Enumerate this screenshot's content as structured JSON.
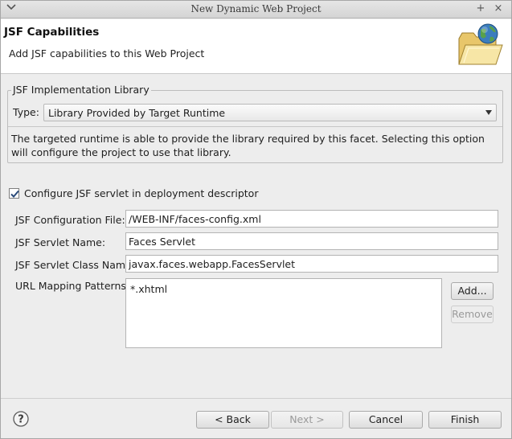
{
  "window": {
    "title": "New Dynamic Web Project",
    "titlebar_icons": [
      "+",
      "×"
    ]
  },
  "banner": {
    "heading": "JSF Capabilities",
    "description": "Add JSF capabilities to this Web Project",
    "image_icon": "folder-globe-icon"
  },
  "implementation": {
    "legend": "JSF Implementation Library",
    "type_label": "Type:",
    "type_value": "Library Provided by Target Runtime",
    "info": "The targeted runtime is able to provide the library required by this facet. Selecting this option will configure the project to use that library."
  },
  "servlet": {
    "checkbox_label": "Configure JSF servlet in deployment descriptor",
    "checked": true,
    "config_file_label": "JSF Configuration File:",
    "config_file_value": "/WEB-INF/faces-config.xml",
    "servlet_name_label": "JSF Servlet Name:",
    "servlet_name_value": "Faces Servlet",
    "servlet_class_label": "JSF Servlet Class Name:",
    "servlet_class_value": "javax.faces.webapp.FacesServlet",
    "url_patterns_label": "URL Mapping Patterns:",
    "url_patterns": [
      "*.xhtml"
    ],
    "add_label": "Add...",
    "remove_label": "Remove"
  },
  "footer": {
    "help_icon": "help-icon",
    "back_label": "< Back",
    "next_label": "Next >",
    "cancel_label": "Cancel",
    "finish_label": "Finish"
  }
}
